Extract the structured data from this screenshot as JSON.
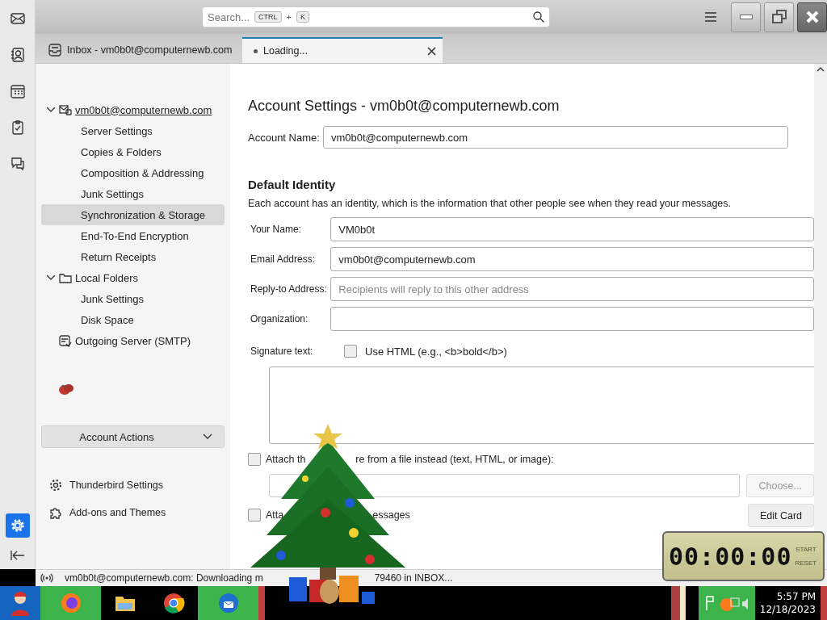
{
  "window": {
    "search": {
      "placeholder": "Search...",
      "shortcut": [
        "CTRL",
        "+",
        "K"
      ]
    }
  },
  "spaces": [
    {
      "kind": "mail",
      "selected": false
    },
    {
      "kind": "contacts",
      "selected": false
    },
    {
      "kind": "calendar",
      "selected": false
    },
    {
      "kind": "tasks",
      "selected": false
    },
    {
      "kind": "chat",
      "selected": false
    },
    {
      "kind": "settings",
      "selected": true
    }
  ],
  "tabs": [
    {
      "title": "Inbox - vm0b0t@computernewb.com",
      "selected": false,
      "loading": false
    },
    {
      "title": "Loading...",
      "selected": true,
      "loading": true
    }
  ],
  "sidebar": {
    "tree": [
      {
        "label": "vm0b0t@computernewb.com",
        "kind": "mail",
        "expanded": true,
        "children": [
          {
            "label": "Server Settings",
            "selected": false
          },
          {
            "label": "Copies & Folders",
            "selected": false
          },
          {
            "label": "Composition & Addressing",
            "selected": false
          },
          {
            "label": "Junk Settings",
            "selected": false
          },
          {
            "label": "Synchronization & Storage",
            "selected": true
          },
          {
            "label": "End-To-End Encryption",
            "selected": false
          },
          {
            "label": "Return Receipts",
            "selected": false
          }
        ]
      },
      {
        "label": "Local Folders",
        "kind": "folder",
        "expanded": true,
        "children": [
          {
            "label": "Junk Settings",
            "selected": false
          },
          {
            "label": "Disk Space",
            "selected": false
          }
        ]
      },
      {
        "label": "Outgoing Server (SMTP)",
        "kind": "smtp"
      }
    ],
    "account_actions": "Account Actions",
    "footer": [
      {
        "label": "Thunderbird Settings",
        "kind": "gear"
      },
      {
        "label": "Add-ons and Themes",
        "kind": "puzzle"
      }
    ]
  },
  "main": {
    "title": "Account Settings - vm0b0t@computernewb.com",
    "account_name": {
      "label": "Account Name:",
      "value": "vm0b0t@computernewb.com"
    },
    "section": "Default Identity",
    "description": "Each account has an identity, which is the information that other people see when they read your messages.",
    "fields": [
      {
        "label": "Your Name:",
        "value": "VM0b0t"
      },
      {
        "label": "Email Address:",
        "value": "vm0b0t@computernewb.com"
      },
      {
        "label": "Reply-to Address:",
        "placeholder": "Recipients will reply to this other address"
      },
      {
        "label": "Organization:"
      }
    ],
    "signature": {
      "label": "Signature text:",
      "html_label": "Use HTML (e.g., <b>bold</b>)",
      "html_checked": false
    },
    "attach_file": {
      "label_start": "Attach th",
      "label_end": "re from a file instead (text, HTML, or image):",
      "checked": false,
      "button": "Choose...",
      "button_disabled": true
    },
    "attach_vcard": {
      "label_start": "Atta",
      "label_end": "essages",
      "checked": false,
      "button": "Edit Card"
    }
  },
  "status_bar": {
    "text_start": "vm0b0t@computernewb.com: Downloading m",
    "text_end": "79460 in INBOX..."
  },
  "timer": {
    "digits": "00:00:00",
    "buttons": [
      "START",
      "RESET"
    ]
  },
  "taskbar": {
    "apps": [
      {
        "kind": "firefox",
        "highlighted": true
      },
      {
        "kind": "explorer",
        "highlighted": false
      },
      {
        "kind": "chrome",
        "highlighted": false
      },
      {
        "kind": "thunderbird",
        "highlighted": true
      }
    ],
    "time": "5:57 PM",
    "date": "12/18/2023"
  }
}
